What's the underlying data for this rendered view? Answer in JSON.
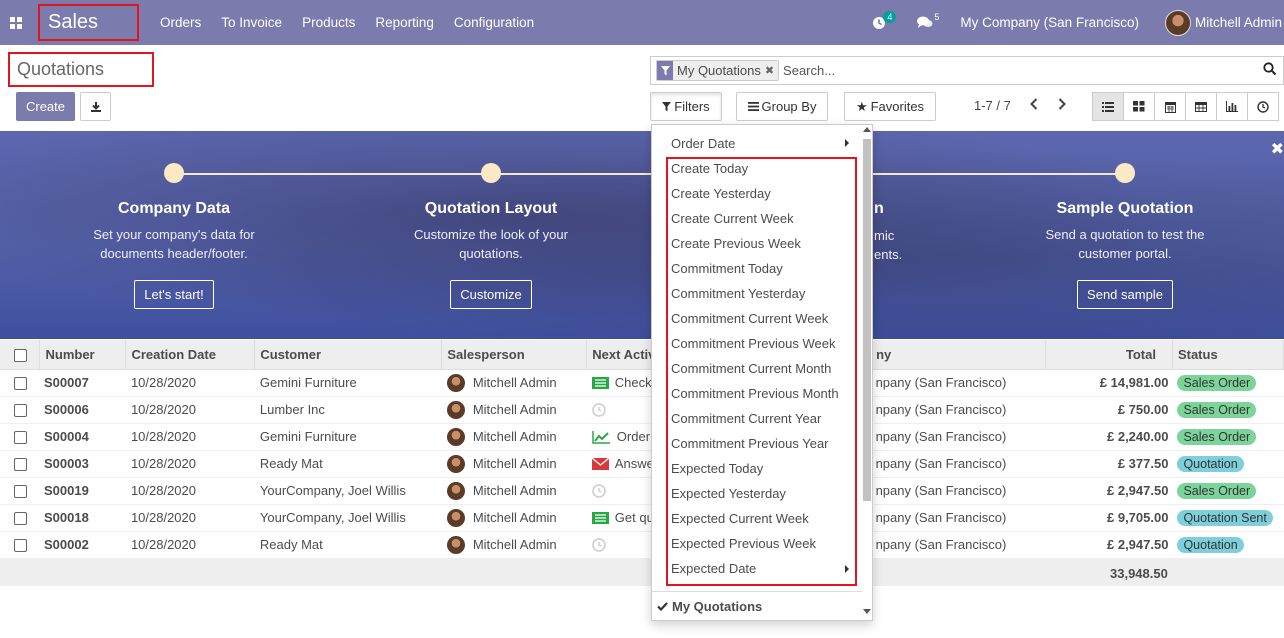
{
  "navbar": {
    "app_name": "Sales",
    "menu": [
      "Orders",
      "To Invoice",
      "Products",
      "Reporting",
      "Configuration"
    ],
    "activity_count": "4",
    "message_count": "5",
    "company": "My Company (San Francisco)",
    "user": "Mitchell Admin",
    "color": "#7c7bad"
  },
  "control_panel": {
    "title": "Quotations",
    "create_label": "Create",
    "facet_label": "My Quotations",
    "search_placeholder": "Search...",
    "filters_label": "Filters",
    "groupby_label": "Group By",
    "favorites_label": "Favorites",
    "pager": "1-7 / 7"
  },
  "onboarding": {
    "steps": [
      {
        "title": "Company Data",
        "desc1": "Set your company's data for",
        "desc2": "documents header/footer.",
        "button": "Let's start!"
      },
      {
        "title": "Quotation Layout",
        "desc1": "Customize the look of your",
        "desc2": "quotations.",
        "button": "Customize"
      },
      {
        "title": "Sample Quotation",
        "desc1": "Send a quotation to test the",
        "desc2": "customer portal.",
        "button": "Send sample"
      }
    ],
    "hidden_partial": {
      "title": "n",
      "desc1": "mic",
      "desc2": "ents."
    }
  },
  "table": {
    "headers": {
      "number": "Number",
      "creation_date": "Creation Date",
      "customer": "Customer",
      "salesperson": "Salesperson",
      "next_activity": "Next Activ",
      "company": "ny",
      "total": "Total",
      "status": "Status"
    },
    "rows": [
      {
        "number": "S00007",
        "date": "10/28/2020",
        "customer": "Gemini Furniture",
        "salesperson": "Mitchell Admin",
        "activity": "Check",
        "activity_icon": "todo-icon",
        "company": "npany (San Francisco)",
        "total": "£ 14,981.00",
        "status": "Sales Order"
      },
      {
        "number": "S00006",
        "date": "10/28/2020",
        "customer": "Lumber Inc",
        "salesperson": "Mitchell Admin",
        "activity": "",
        "activity_icon": "clock-icon",
        "company": "npany (San Francisco)",
        "total": "£ 750.00",
        "status": "Sales Order"
      },
      {
        "number": "S00004",
        "date": "10/28/2020",
        "customer": "Gemini Furniture",
        "salesperson": "Mitchell Admin",
        "activity": "Order",
        "activity_icon": "chart-icon",
        "company": "npany (San Francisco)",
        "total": "£ 2,240.00",
        "status": "Sales Order"
      },
      {
        "number": "S00003",
        "date": "10/28/2020",
        "customer": "Ready Mat",
        "salesperson": "Mitchell Admin",
        "activity": "Answe",
        "activity_icon": "email-icon",
        "company": "npany (San Francisco)",
        "total": "£ 377.50",
        "status": "Quotation"
      },
      {
        "number": "S00019",
        "date": "10/28/2020",
        "customer": "YourCompany, Joel Willis",
        "salesperson": "Mitchell Admin",
        "activity": "",
        "activity_icon": "clock-icon",
        "company": "npany (San Francisco)",
        "total": "£ 2,947.50",
        "status": "Sales Order"
      },
      {
        "number": "S00018",
        "date": "10/28/2020",
        "customer": "YourCompany, Joel Willis",
        "salesperson": "Mitchell Admin",
        "activity": "Get qu",
        "activity_icon": "todo-icon",
        "company": "npany (San Francisco)",
        "total": "£ 9,705.00",
        "status": "Quotation Sent"
      },
      {
        "number": "S00002",
        "date": "10/28/2020",
        "customer": "Ready Mat",
        "salesperson": "Mitchell Admin",
        "activity": "",
        "activity_icon": "clock-icon",
        "company": "npany (San Francisco)",
        "total": "£ 2,947.50",
        "status": "Quotation"
      }
    ],
    "sum_total": "33,948.50",
    "status_colors": {
      "Sales Order": "#7cd49b",
      "Quotation": "#7dcfdb",
      "Quotation Sent": "#7dcfdb"
    }
  },
  "filters_dropdown": {
    "order_date": "Order Date",
    "items": [
      "Create Today",
      "Create Yesterday",
      "Create Current Week",
      "Create Previous Week",
      "Commitment Today",
      "Commitment Yesterday",
      "Commitment Current Week",
      "Commitment Previous Week",
      "Commitment Current Month",
      "Commitment Previous Month",
      "Commitment Current Year",
      "Commitment Previous Year",
      "Expected Today",
      "Expected Yesterday",
      "Expected Current Week",
      "Expected Previous Week",
      "Expected Date"
    ],
    "my_quotations": "My Quotations",
    "highlight_color": "#e0161f"
  }
}
